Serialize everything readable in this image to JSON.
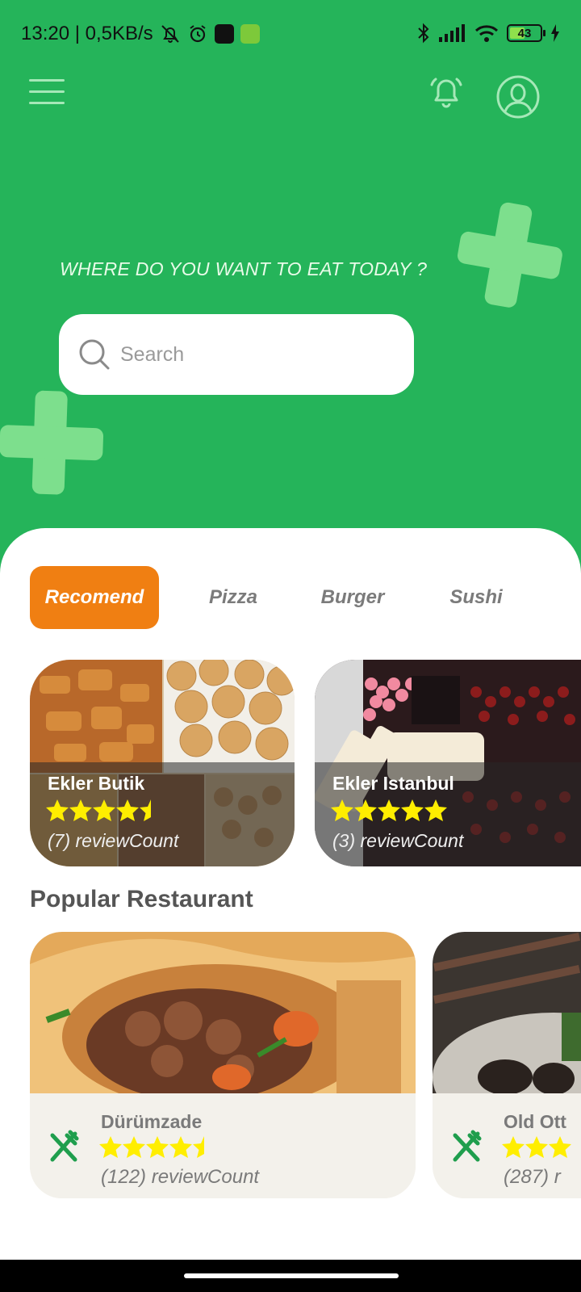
{
  "status_bar": {
    "left_text": "13:20 | 0,5KB/s",
    "battery": "43"
  },
  "header": {
    "menu_icon": "hamburger-menu-icon",
    "bell_icon": "bell-icon",
    "profile_icon": "user-profile-icon"
  },
  "hero": {
    "question": "WHERE DO YOU WANT TO EAT TODAY ?",
    "search_placeholder": "Search"
  },
  "tabs": [
    {
      "label": "Recomend",
      "active": true
    },
    {
      "label": "Pizza",
      "active": false
    },
    {
      "label": "Burger",
      "active": false
    },
    {
      "label": "Sushi",
      "active": false
    }
  ],
  "recommended": [
    {
      "name": "Ekler Butik",
      "rating": 4.5,
      "reviews": "(7) reviewCount"
    },
    {
      "name": "Ekler Istanbul",
      "rating": 5,
      "reviews": "(3) reviewCount"
    }
  ],
  "popular": {
    "title": "Popular Restaurant",
    "items": [
      {
        "name": "Dürümzade",
        "rating": 4.5,
        "reviews": "(122) reviewCount"
      },
      {
        "name": "Old Ott",
        "rating": 3,
        "reviews": "(287) r"
      }
    ]
  },
  "colors": {
    "primary_green": "#25b45a",
    "accent_orange": "#f07f12",
    "star_yellow": "#ffee00",
    "icon_green": "#1f9e4d"
  }
}
